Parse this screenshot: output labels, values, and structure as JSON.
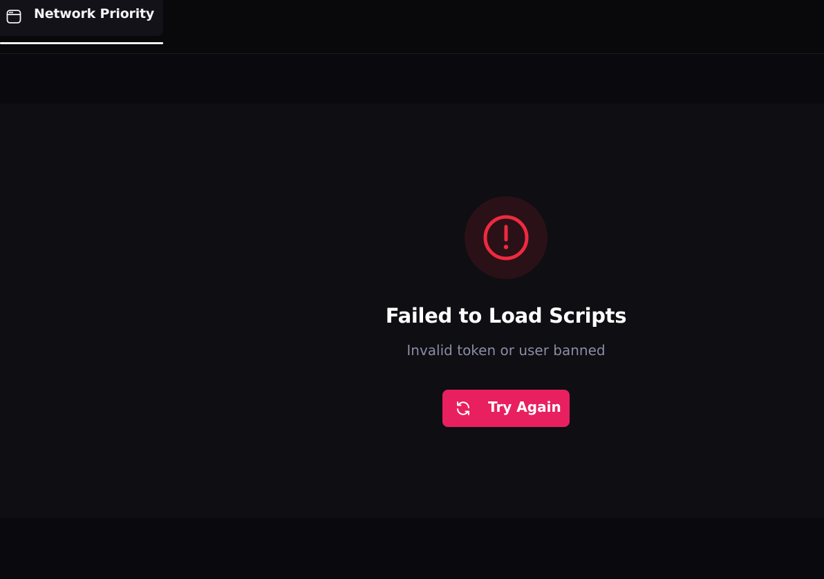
{
  "tab": {
    "label": "Network Priority",
    "icon": "browser-window-icon",
    "active": true
  },
  "error": {
    "icon": "alert-circle-icon",
    "title": "Failed to Load Scripts",
    "message": "Invalid token or user banned",
    "retry_label": "Try Again",
    "retry_icon": "refresh-icon"
  },
  "colors": {
    "background": "#0a0a0e",
    "panel": "#0e0e13",
    "error_red": "#ee2a3f",
    "error_icon_bg": "#2a1117",
    "accent_button": "#e8205f",
    "subtitle": "#8b8da3"
  }
}
